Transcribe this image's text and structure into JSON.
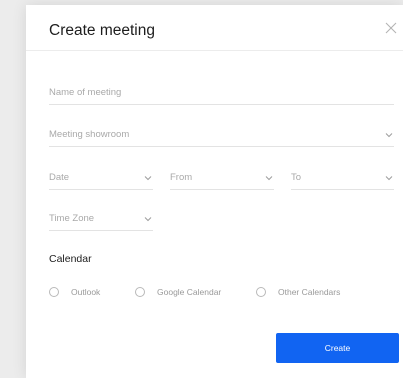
{
  "modal": {
    "title": "Create meeting"
  },
  "form": {
    "name_placeholder": "Name of meeting",
    "showroom_placeholder": "Meeting showroom",
    "date_placeholder": "Date",
    "from_placeholder": "From",
    "to_placeholder": "To",
    "timezone_placeholder": "Time Zone",
    "calendar_label": "Calendar",
    "calendar_options": [
      {
        "label": "Outlook"
      },
      {
        "label": "Google Calendar"
      },
      {
        "label": "Other Calendars"
      }
    ],
    "create_label": "Create"
  },
  "colors": {
    "accent": "#1164f2",
    "placeholder": "#a9a9a9",
    "divider": "#e3e3e3"
  },
  "icons": {
    "close": "close-icon",
    "dropdown": "chevron-down-icon",
    "radio": "radio-empty"
  }
}
